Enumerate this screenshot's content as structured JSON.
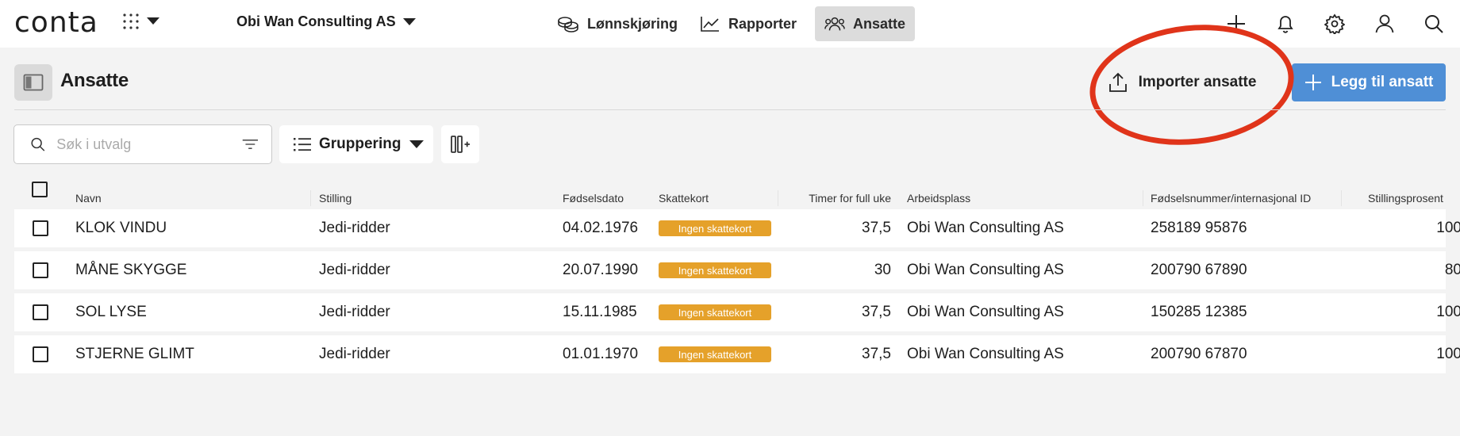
{
  "app": {
    "logo": "conta",
    "company": "Obi Wan Consulting AS"
  },
  "nav": [
    {
      "label": "Lønnskjøring",
      "icon": "coins-icon"
    },
    {
      "label": "Rapporter",
      "icon": "chart-line-icon"
    },
    {
      "label": "Ansatte",
      "icon": "users-icon",
      "active": true
    }
  ],
  "page": {
    "title": "Ansatte",
    "import_label": "Importer ansatte",
    "add_label": "Legg til ansatt"
  },
  "filters": {
    "search_placeholder": "Søk i utvalg",
    "search_value": "",
    "group_label": "Gruppering"
  },
  "columns": [
    "Navn",
    "Stilling",
    "Fødselsdato",
    "Skattekort",
    "Timer for full uke",
    "Arbeidsplass",
    "Fødselsnummer/internasjonal ID",
    "Stillingsprosent"
  ],
  "rows": [
    {
      "name": "KLOK VINDU",
      "position": "Jedi-ridder",
      "birthdate": "04.02.1976",
      "taxcard": "Ingen skattekort",
      "hours": "37,5",
      "workplace": "Obi Wan Consulting AS",
      "id": "258189 95876",
      "percent": "100"
    },
    {
      "name": "MÅNE SKYGGE",
      "position": "Jedi-ridder",
      "birthdate": "20.07.1990",
      "taxcard": "Ingen skattekort",
      "hours": "30",
      "workplace": "Obi Wan Consulting AS",
      "id": "200790 67890",
      "percent": "80"
    },
    {
      "name": "SOL LYSE",
      "position": "Jedi-ridder",
      "birthdate": "15.11.1985",
      "taxcard": "Ingen skattekort",
      "hours": "37,5",
      "workplace": "Obi Wan Consulting AS",
      "id": "150285 12385",
      "percent": "100"
    },
    {
      "name": "STJERNE GLIMT",
      "position": "Jedi-ridder",
      "birthdate": "01.01.1970",
      "taxcard": "Ingen skattekort",
      "hours": "37,5",
      "workplace": "Obi Wan Consulting AS",
      "id": "200790 67870",
      "percent": "100"
    }
  ],
  "colors": {
    "accent": "#4f8fd6",
    "badge": "#e5a12a",
    "highlight": "#e0341a"
  }
}
